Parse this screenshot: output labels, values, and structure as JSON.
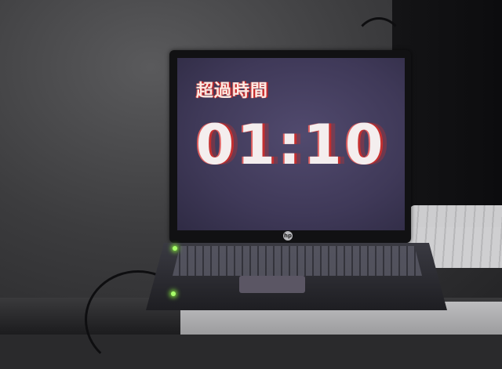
{
  "screen": {
    "label": "超過時間",
    "timer": "01:10"
  },
  "laptop": {
    "logo": "hp"
  },
  "colors": {
    "screen_bg": "#453f5f",
    "text": "#f4eeee",
    "accent_red": "#c43030"
  }
}
